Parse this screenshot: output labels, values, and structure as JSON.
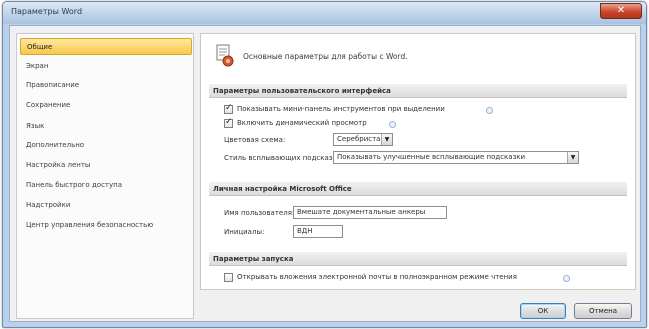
{
  "window": {
    "title": "Параметры Word",
    "close_glyph": "✕"
  },
  "sidebar": {
    "items": [
      {
        "label": "Общие"
      },
      {
        "label": "Экран"
      },
      {
        "label": "Правописание"
      },
      {
        "label": "Сохранение"
      },
      {
        "label": "Язык"
      },
      {
        "label": "Дополнительно"
      },
      {
        "label": "Настройка ленты"
      },
      {
        "label": "Панель быстрого доступа"
      },
      {
        "label": "Надстройки"
      },
      {
        "label": "Центр управления безопасностью"
      }
    ],
    "selected_index": 0
  },
  "content": {
    "header_text": "Основные параметры для работы с Word.",
    "sections": {
      "ui": "Параметры пользовательского интерфейса",
      "personal": "Личная настройка Microsoft Office",
      "startup": "Параметры запуска"
    },
    "ui_options": {
      "mini_toolbar": {
        "label": "Показывать мини-панель инструментов при выделении",
        "checked": true
      },
      "live_preview": {
        "label": "Включить динамический просмотр",
        "checked": true
      },
      "color_scheme_label": "Цветовая схема:",
      "color_scheme_value": "Серебристая",
      "screentip_label": "Стиль всплывающих подсказок:",
      "screentip_value": "Показывать улучшенные всплывающие подсказки"
    },
    "personal": {
      "username_label": "Имя пользователя:",
      "username_value": "Вмешате документальные анкеры",
      "initials_label": "Инициалы:",
      "initials_value": "ВДН"
    },
    "startup": {
      "open_attachments": {
        "label": "Открывать вложения электронной почты в полноэкранном режиме чтения",
        "checked": false
      }
    }
  },
  "footer": {
    "ok_label": "ОК",
    "cancel_label": "Отмена"
  },
  "icons": {
    "check_glyph": "✓",
    "dropdown_glyph": "▼"
  }
}
